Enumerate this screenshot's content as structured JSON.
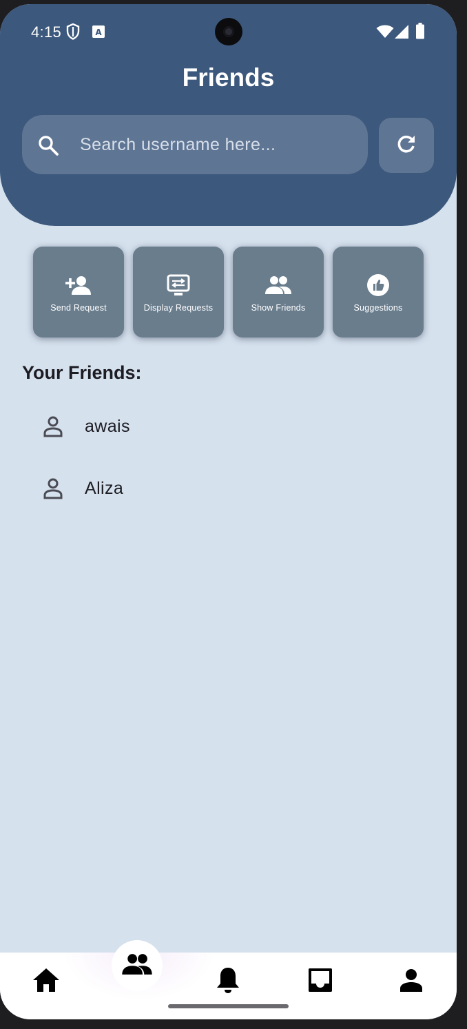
{
  "status_bar": {
    "time": "4:15"
  },
  "header": {
    "title": "Friends"
  },
  "search": {
    "placeholder": "Search username here...",
    "value": ""
  },
  "actions": [
    {
      "label": "Send Request",
      "icon": "person-add-icon"
    },
    {
      "label": "Display Requests",
      "icon": "display-requests-icon"
    },
    {
      "label": "Show Friends",
      "icon": "people-icon"
    },
    {
      "label": "Suggestions",
      "icon": "thumb-up-icon"
    }
  ],
  "friends_section": {
    "title": "Your Friends:",
    "items": [
      {
        "name": "awais"
      },
      {
        "name": "Aliza"
      }
    ]
  },
  "bottom_nav": {
    "items": [
      {
        "icon": "home-icon"
      },
      {
        "icon": "people-icon",
        "active": true
      },
      {
        "icon": "bell-icon"
      },
      {
        "icon": "inbox-icon"
      },
      {
        "icon": "person-icon"
      }
    ]
  },
  "colors": {
    "header": "#3c587c",
    "background": "#d6e1ee",
    "action_button": "#6a7d8d",
    "search_box": "#5f7594"
  }
}
